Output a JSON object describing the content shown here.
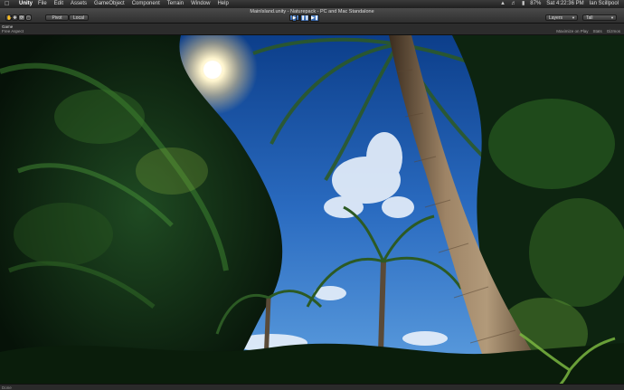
{
  "menubar": {
    "app_name": "Unity",
    "items": [
      "File",
      "Edit",
      "Assets",
      "GameObject",
      "Component",
      "Terrain",
      "Window",
      "Help"
    ],
    "battery": "87%",
    "clock": "Sat 4:22:36 PM",
    "user": "Ian Scillpool",
    "icons": [
      "apple-icon",
      "wifi-icon",
      "volume-icon",
      "battery-icon"
    ]
  },
  "toolbar": {
    "window_title": "MainIsland.unity - Naturepack - PC and Mac Standalone",
    "pivot_label": "Pivot",
    "local_label": "Local",
    "layers_label": "Layers",
    "layout_label": "Tall",
    "play_icons": [
      "play-icon",
      "pause-icon",
      "step-icon"
    ]
  },
  "gameview": {
    "tab_label": "Game",
    "aspect_label": "Free Aspect",
    "maximize_label": "Maximize on Play",
    "stats_label": "Stats",
    "gizmos_label": "Gizmos"
  },
  "statusbar": {
    "text": "Done"
  }
}
